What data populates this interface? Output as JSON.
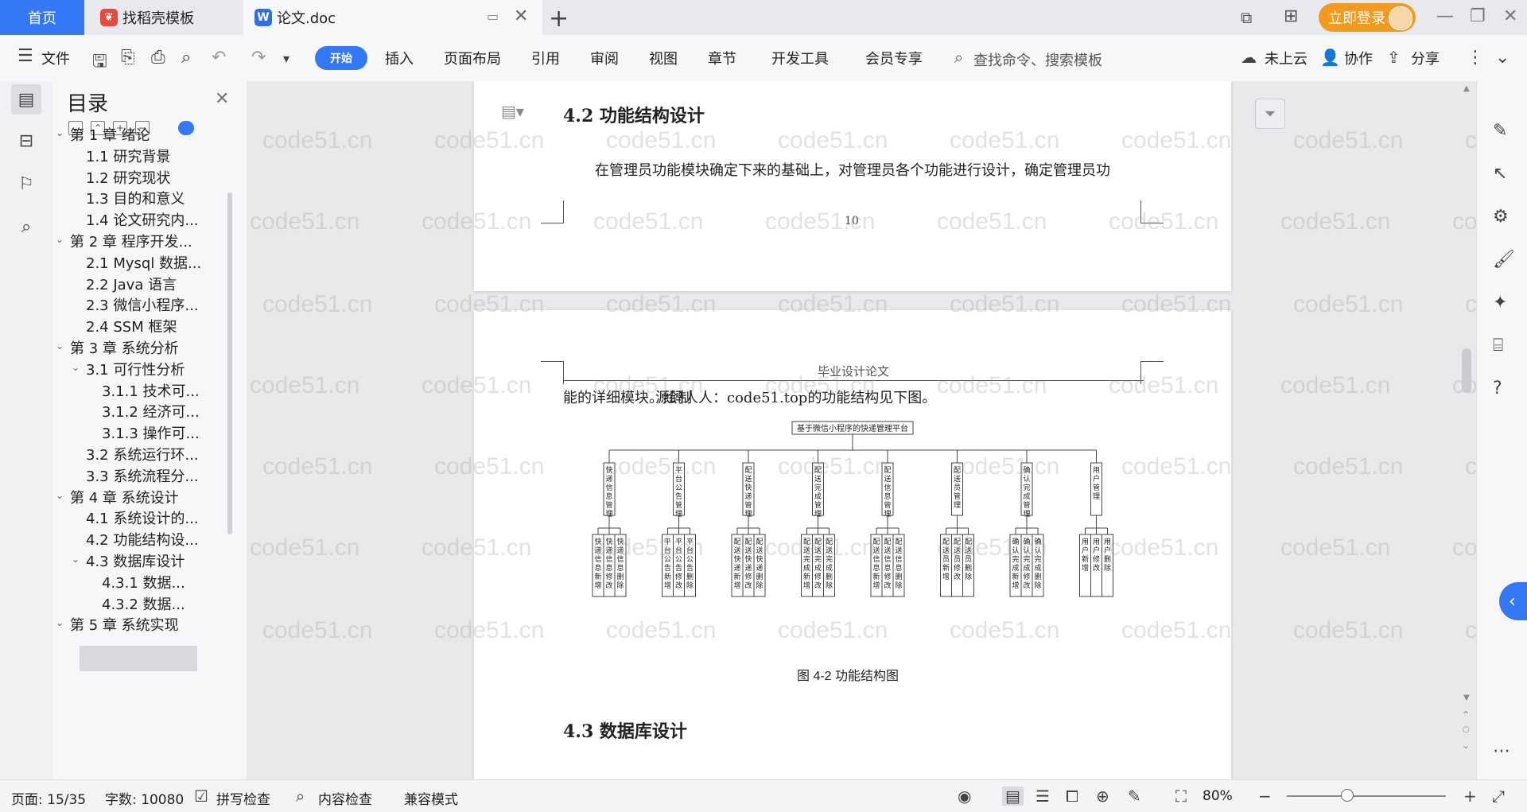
{
  "tabs": {
    "home": "首页",
    "template": "找稻壳模板",
    "doc": "论文.doc"
  },
  "header_right": {
    "login": "立即登录"
  },
  "toolbar": {
    "file": "文件",
    "menus": [
      "开始",
      "插入",
      "页面布局",
      "引用",
      "审阅",
      "视图",
      "章节",
      "开发工具",
      "会员专享"
    ],
    "search_placeholder": "查找命令、搜索模板",
    "cloud": "未上云",
    "collab": "协作",
    "share": "分享"
  },
  "toc": {
    "title": "目录",
    "items": [
      {
        "label": "第 1 章  绪论",
        "level": 1,
        "expanded": true
      },
      {
        "label": "1.1  研究背景",
        "level": 2
      },
      {
        "label": "1.2  研究现状",
        "level": 2
      },
      {
        "label": "1.3  目的和意义",
        "level": 2
      },
      {
        "label": "1.4  论文研究内...",
        "level": 2
      },
      {
        "label": "第 2 章  程序开发...",
        "level": 1,
        "expanded": true
      },
      {
        "label": "2.1 Mysql 数据...",
        "level": 2
      },
      {
        "label": "2.2 Java 语言",
        "level": 2
      },
      {
        "label": "2.3  微信小程序...",
        "level": 2
      },
      {
        "label": "2.4 SSM 框架",
        "level": 2
      },
      {
        "label": "第 3 章  系统分析",
        "level": 1,
        "expanded": true
      },
      {
        "label": "3.1 可行性分析",
        "level": 2,
        "expanded": true
      },
      {
        "label": "3.1.1 技术可...",
        "level": 3
      },
      {
        "label": "3.1.2 经济可...",
        "level": 3
      },
      {
        "label": "3.1.3 操作可...",
        "level": 3
      },
      {
        "label": "3.2 系统运行环...",
        "level": 2
      },
      {
        "label": "3.3 系统流程分...",
        "level": 2
      },
      {
        "label": "第 4 章  系统设计",
        "level": 1,
        "expanded": true
      },
      {
        "label": "4.1  系统设计的...",
        "level": 2
      },
      {
        "label": "4.2  功能结构设...",
        "level": 2,
        "active": true
      },
      {
        "label": "4.3  数据库设计",
        "level": 2,
        "expanded": true
      },
      {
        "label": "4.3.1  数据...",
        "level": 3
      },
      {
        "label": "4.3.2  数据...",
        "level": 3
      },
      {
        "label": "第 5 章  系统实现",
        "level": 1,
        "expanded": true
      }
    ]
  },
  "document": {
    "heading_42": "4.2  功能结构设计",
    "para1": "在管理员功能模块确定下来的基础上，对管理员各个功能进行设计，确定管理员功",
    "page_number": "10",
    "page_header": "毕业设计论文",
    "para2_a": "能的详细模块。绘制",
    "para2_b": "源码人人：code51.top",
    "para2_c": "的功能结构见下图。",
    "chart_root": "基于微信小程序的快递管理平台",
    "modules": [
      {
        "name": "快递信息管理",
        "subs": [
          "快递信息新增",
          "快递信息修改",
          "快递信息删除"
        ]
      },
      {
        "name": "平台公告管理",
        "subs": [
          "平台公告新增",
          "平台公告修改",
          "平台公告删除"
        ]
      },
      {
        "name": "配送快递管理",
        "subs": [
          "配送快递新增",
          "配送快递修改",
          "配送快递删除"
        ]
      },
      {
        "name": "配送完成管理",
        "subs": [
          "配送完成新增",
          "配送完成修改",
          "配送完成删除"
        ]
      },
      {
        "name": "配送信息管理",
        "subs": [
          "配送信息新增",
          "配送信息修改",
          "配送信息删除"
        ]
      },
      {
        "name": "配送员管理",
        "subs": [
          "配送员新增",
          "配送员修改",
          "配送员删除"
        ]
      },
      {
        "name": "确认完成管理",
        "subs": [
          "确认完成新增",
          "确认完成修改",
          "确认完成删除"
        ]
      },
      {
        "name": "用户管理",
        "subs": [
          "用户新增",
          "用户修改",
          "用户删除"
        ]
      }
    ],
    "figure_caption": "图 4-2  功能结构图",
    "heading_43": "4.3  数据库设计",
    "watermark": "code51.cn"
  },
  "status": {
    "page": "页面: 15/35",
    "words": "字数: 10080",
    "spell": "拼写检查",
    "content": "内容检查",
    "compat": "兼容模式",
    "zoom": "80%"
  },
  "colors": {
    "accent": "#3478f6",
    "login": "#f29a1f"
  }
}
